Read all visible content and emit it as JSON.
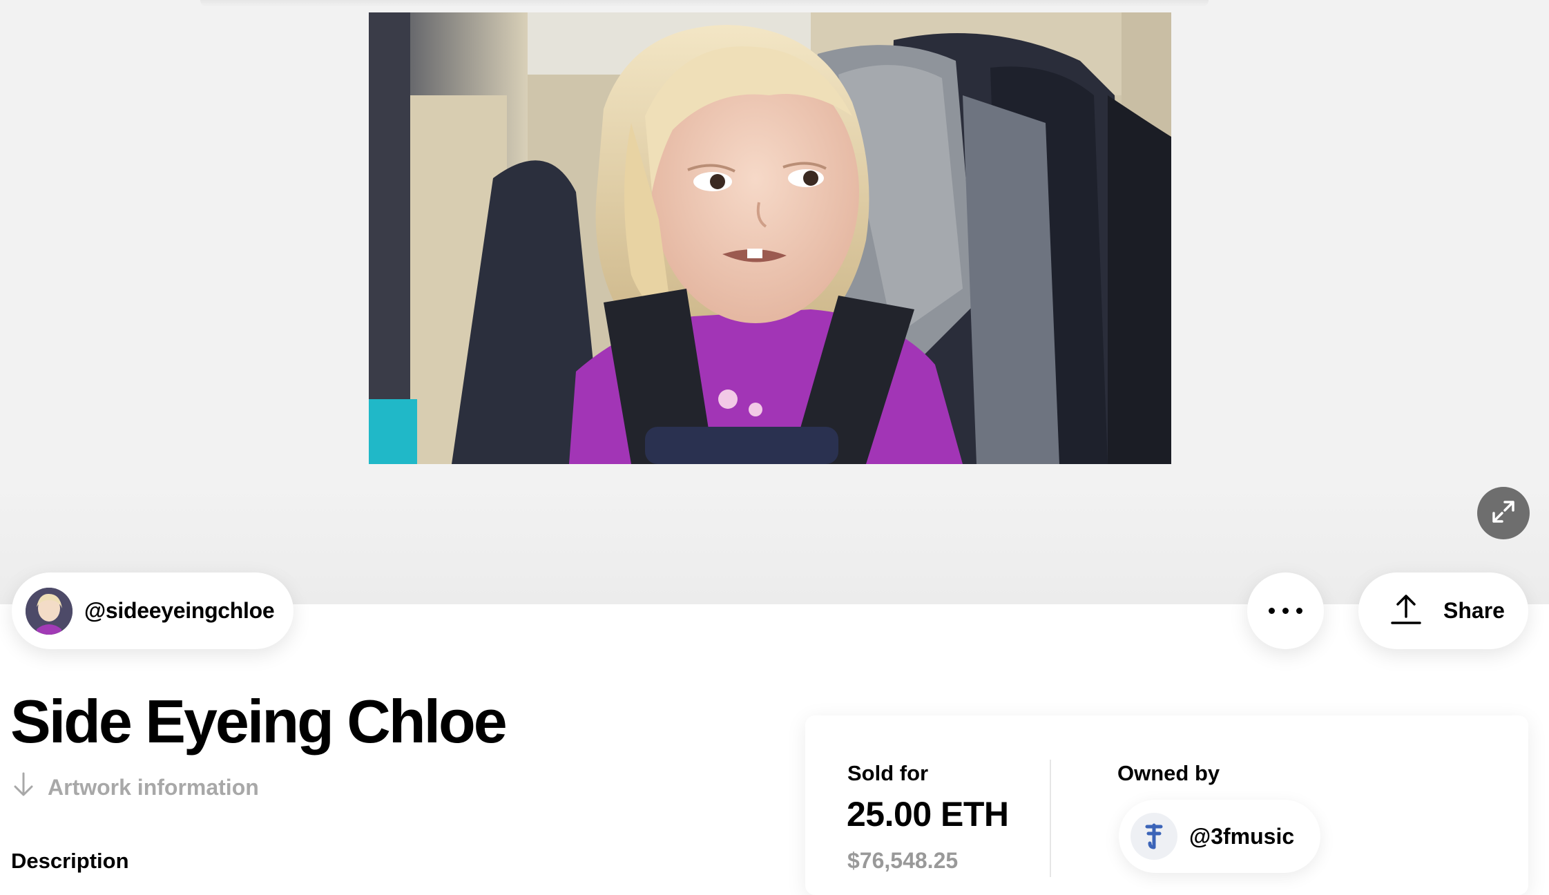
{
  "artwork": {
    "title": "Side Eyeing Chloe",
    "creator_handle": "@sideeyeingchloe",
    "artwork_info_link": "Artwork information",
    "description_heading": "Description"
  },
  "actions": {
    "share_label": "Share"
  },
  "sale": {
    "sold_label": "Sold for",
    "price_eth": "25.00 ETH",
    "price_usd": "$76,548.25",
    "owned_label": "Owned by",
    "owner_handle": "@3fmusic"
  },
  "icons": {
    "expand": "expand-arrows-icon",
    "more": "more-dots-icon",
    "share": "upload-arrow-icon",
    "artwork_info": "arrow-down-icon"
  },
  "colors": {
    "hero_background": "#f2f2f2",
    "muted_text": "#999999",
    "expand_button": "#6e6e6e"
  }
}
